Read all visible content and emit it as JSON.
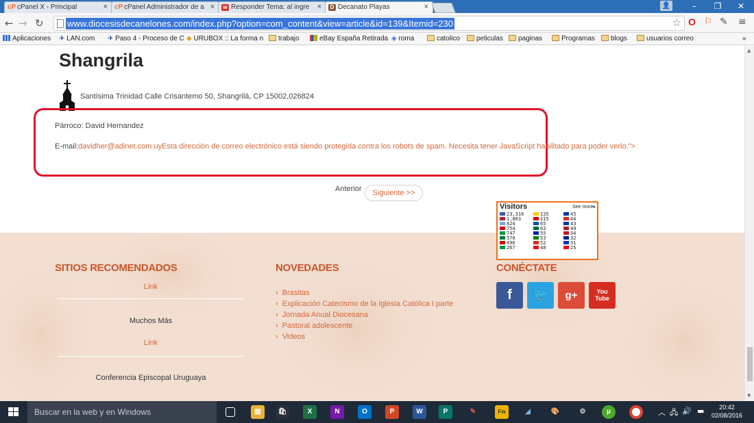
{
  "browser": {
    "tabs": [
      {
        "label": "cPanel X - Principal",
        "icon": "cP",
        "icon_color": "#ff6c2c"
      },
      {
        "label": "cPanel Administrador de a",
        "icon": "cP",
        "icon_color": "#ff6c2c"
      },
      {
        "label": "Responder Tema: al ingre",
        "icon": "w",
        "icon_color": "#d9352b"
      },
      {
        "label": "Decanato Playas",
        "icon": "D",
        "icon_color": "#8b5a3c"
      }
    ],
    "url": "www.diocesisdecanelones.com/index.php?option=com_content&view=article&id=139&Itemid=230",
    "bookmarks": [
      {
        "label": "Aplicaciones",
        "type": "apps"
      },
      {
        "label": "LAN.com",
        "type": "plane"
      },
      {
        "label": "Paso 4 - Proceso de C",
        "type": "plane"
      },
      {
        "label": "URUBOX :: La forma n",
        "type": "box"
      },
      {
        "label": "trabajo",
        "type": "folder"
      },
      {
        "label": "eBay España Retirada",
        "type": "ebay"
      },
      {
        "label": "roma",
        "type": "site"
      },
      {
        "label": "catolico",
        "type": "folder"
      },
      {
        "label": "peliculas",
        "type": "folder"
      },
      {
        "label": "paginas",
        "type": "folder"
      },
      {
        "label": "Programas",
        "type": "folder"
      },
      {
        "label": "blogs",
        "type": "folder"
      },
      {
        "label": "usuarios correo",
        "type": "folder"
      }
    ],
    "bookmarks_more": "»"
  },
  "article": {
    "title": "Shangrila",
    "address": "Santísima Trinidad Calle Crisantemo 50, Shangrilá, CP 15002,026824",
    "parroco": "Párroco: David Hernandez",
    "email_label": "E-mail:",
    "email_text": "davidher@adinet.com.uyEsta dirección de correo electrónico está siendo protegida contra los robots de spam. Necesita tener JavaScript habilitado para poder verlo.\">",
    "prev_label": "Anterior",
    "next_label": "Siguiente >>",
    "highlight_color": "#e0102a"
  },
  "footer": {
    "col1": {
      "title": "SITIOS RECOMENDADOS",
      "items": [
        {
          "text": "Link",
          "style": "link"
        },
        {
          "text": "Muchos Más",
          "style": "dark"
        },
        {
          "text": "Link",
          "style": "link"
        },
        {
          "text": "Conferencia Episcopal Uruguaya",
          "style": "dark"
        }
      ]
    },
    "col2": {
      "title": "NOVEDADES",
      "items": [
        "Brasitas",
        "Explicación Catecismo de la Iglesia Católica I parte",
        "Jornada Anual Diocesana",
        "Pastoral adolescente",
        "Videos"
      ]
    },
    "col3": {
      "title": "CONÉCTATE",
      "social": [
        {
          "name": "facebook",
          "glyph": "f",
          "color": "#3b5998"
        },
        {
          "name": "twitter",
          "glyph": "🐦",
          "color": "#2ba3e1"
        },
        {
          "name": "google-plus",
          "glyph": "g+",
          "color": "#dd4b39"
        },
        {
          "name": "youtube",
          "glyph": "You\nTube",
          "color": "#d62d20"
        }
      ]
    },
    "accent": "#c9552a",
    "link_color": "#d4673a"
  },
  "visitors": {
    "title": "Visitors",
    "see_more": "See more",
    "col1": [
      {
        "count": "23,316",
        "flag": "#3c5aa0"
      },
      {
        "count": "1,863",
        "flag": "#b22234"
      },
      {
        "count": "824",
        "flag": "#74acdf"
      },
      {
        "count": "754",
        "flag": "#c60b1e"
      },
      {
        "count": "747",
        "flag": "#009c3b"
      },
      {
        "count": "570",
        "flag": "#0a7a3c"
      },
      {
        "count": "496",
        "flag": "#cc0000"
      },
      {
        "count": "267",
        "flag": "#009246"
      }
    ],
    "col2": [
      {
        "count": "135",
        "flag": "#ffcd00"
      },
      {
        "count": "115",
        "flag": "#dd0000"
      },
      {
        "count": "65",
        "flag": "#0055a4"
      },
      {
        "count": "63",
        "flag": "#006847"
      },
      {
        "count": "55",
        "flag": "#002395"
      },
      {
        "count": "53",
        "flag": "#008000"
      },
      {
        "count": "52",
        "flag": "#d52b1e"
      },
      {
        "count": "48",
        "flag": "#e30a17"
      }
    ],
    "col3": [
      {
        "count": "45",
        "flag": "#0039a6"
      },
      {
        "count": "44",
        "flag": "#d52b1e"
      },
      {
        "count": "43",
        "flag": "#0038a8"
      },
      {
        "count": "40",
        "flag": "#ae1c28"
      },
      {
        "count": "34",
        "flag": "#ce1126"
      },
      {
        "count": "32",
        "flag": "#00247d"
      },
      {
        "count": "31",
        "flag": "#0038b8"
      },
      {
        "count": "25",
        "flag": "#ff0000"
      }
    ]
  },
  "taskbar": {
    "search_placeholder": "Buscar en la web y en Windows",
    "time": "20:42",
    "date": "02/08/2016"
  }
}
